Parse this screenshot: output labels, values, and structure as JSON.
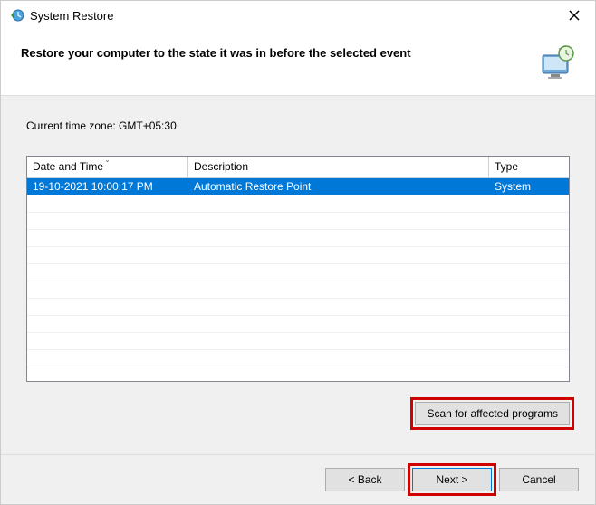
{
  "title": "System Restore",
  "header": {
    "text": "Restore your computer to the state it was in before the selected event"
  },
  "timezone_label": "Current time zone: GMT+05:30",
  "table": {
    "columns": {
      "date": "Date and Time",
      "desc": "Description",
      "type": "Type"
    },
    "rows": [
      {
        "date": "19-10-2021 10:00:17 PM",
        "desc": "Automatic Restore Point",
        "type": "System",
        "selected": true
      }
    ]
  },
  "buttons": {
    "scan": "Scan for affected programs",
    "back": "< Back",
    "next": "Next >",
    "cancel": "Cancel"
  }
}
